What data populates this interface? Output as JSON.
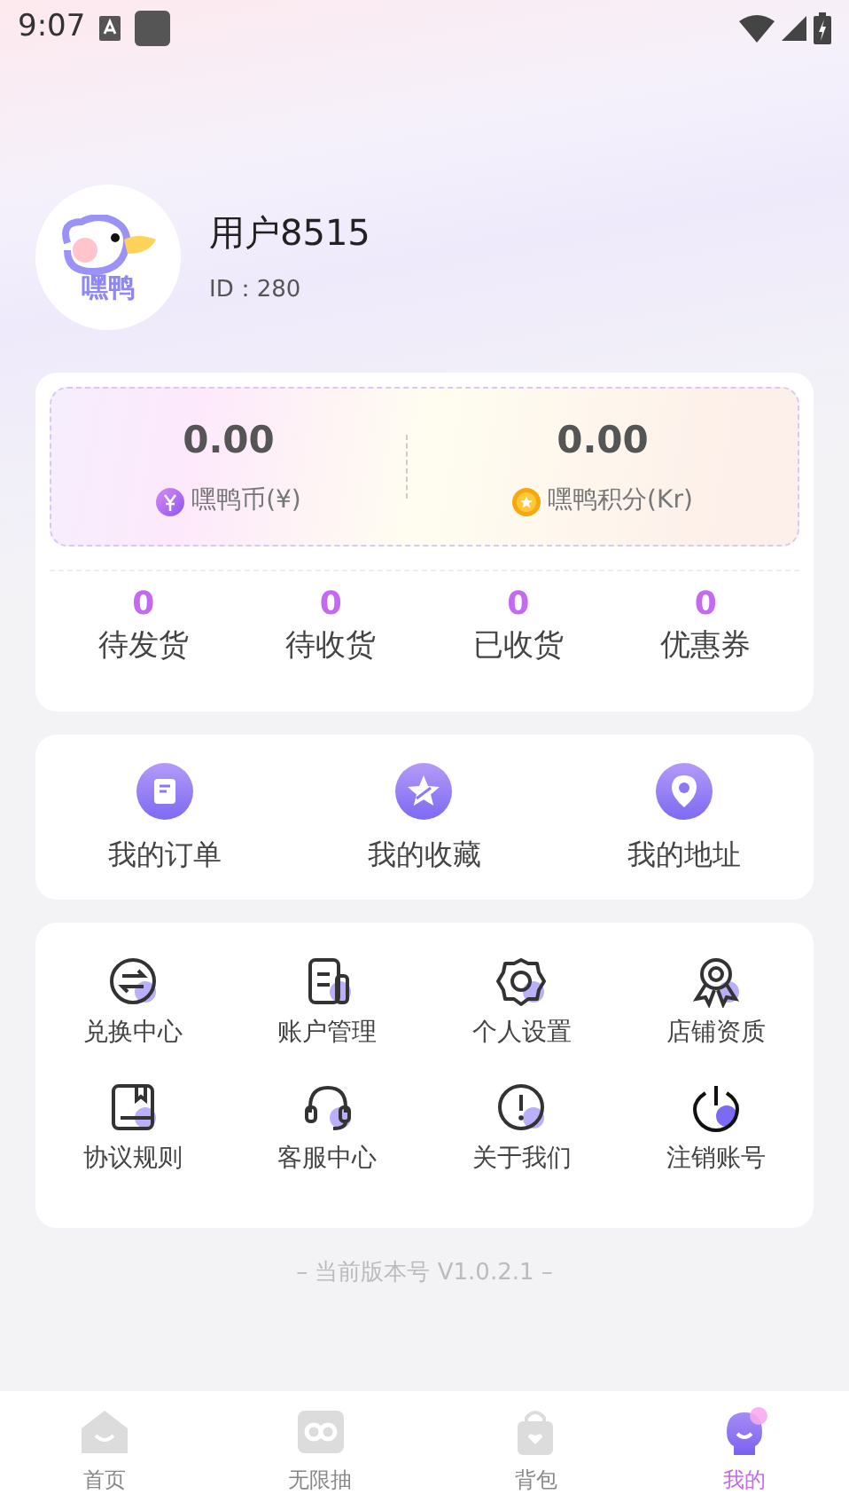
{
  "status_bar": {
    "time": "9:07"
  },
  "profile": {
    "logo_text": "嘿鸭",
    "name": "用户8515",
    "id": "ID：280"
  },
  "wallet": [
    {
      "amount": "0.00",
      "label": "嘿鸭币(¥)"
    },
    {
      "amount": "0.00",
      "label": "嘿鸭积分(Kr)"
    }
  ],
  "order_stats": [
    {
      "count": "0",
      "label": "待发货"
    },
    {
      "count": "0",
      "label": "待收货"
    },
    {
      "count": "0",
      "label": "已收货"
    },
    {
      "count": "0",
      "label": "优惠券"
    }
  ],
  "shortcuts": [
    {
      "label": "我的订单"
    },
    {
      "label": "我的收藏"
    },
    {
      "label": "我的地址"
    }
  ],
  "services": [
    {
      "label": "兑换中心"
    },
    {
      "label": "账户管理"
    },
    {
      "label": "个人设置"
    },
    {
      "label": "店铺资质"
    },
    {
      "label": "协议规则"
    },
    {
      "label": "客服中心"
    },
    {
      "label": "关于我们"
    },
    {
      "label": "注销账号"
    }
  ],
  "version": "– 当前版本号 V1.0.2.1 –",
  "tabs": [
    {
      "label": "首页",
      "selected": false
    },
    {
      "label": "无限抽",
      "selected": false
    },
    {
      "label": "背包",
      "selected": false
    },
    {
      "label": "我的",
      "selected": true
    }
  ]
}
